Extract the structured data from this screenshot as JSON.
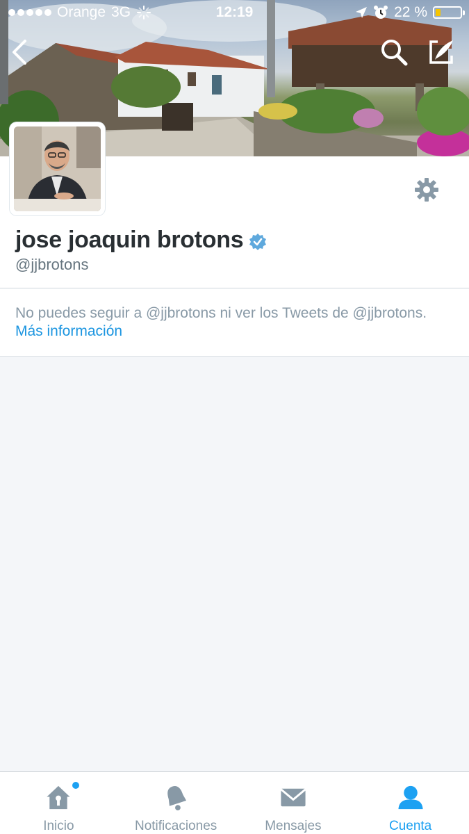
{
  "status_bar": {
    "carrier": "Orange",
    "network": "3G",
    "time": "12:19",
    "battery_percent": "22 %",
    "battery_level": 0.22
  },
  "header": {
    "back_icon": "chevron-left-icon",
    "search_icon": "search-icon",
    "compose_icon": "compose-icon"
  },
  "profile": {
    "name": "jose joaquin brotons",
    "handle": "@jjbrotons",
    "verified": true,
    "settings_icon": "gear-icon"
  },
  "notice": {
    "text": "No puedes seguir a @jjbrotons ni ver los Tweets de @jjbrotons.",
    "link": "Más información"
  },
  "tabs": [
    {
      "label": "Inicio",
      "icon": "home-icon",
      "active": false,
      "badge": true
    },
    {
      "label": "Notificaciones",
      "icon": "bell-icon",
      "active": false,
      "badge": false
    },
    {
      "label": "Mensajes",
      "icon": "envelope-icon",
      "active": false,
      "badge": false
    },
    {
      "label": "Cuenta",
      "icon": "person-icon",
      "active": true,
      "badge": false
    }
  ],
  "colors": {
    "accent": "#1da1f2",
    "link": "#1b95e0",
    "muted": "#8899a6",
    "background": "#f4f6f9"
  }
}
